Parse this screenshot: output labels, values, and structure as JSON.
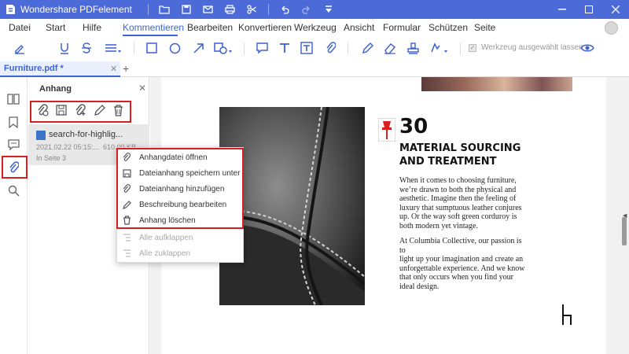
{
  "window": {
    "title": "Wondershare PDFelement"
  },
  "menu": [
    "Datei",
    "Start",
    "Hilfe",
    "Kommentieren",
    "Bearbeiten",
    "Konvertieren",
    "Werkzeug",
    "Ansicht",
    "Formular",
    "Schützen",
    "Seite"
  ],
  "menu_active": "Kommentieren",
  "toolbar": {
    "keep_tool_label": "Werkzeug ausgewählt lassen",
    "keep_tool_checked": true
  },
  "tab": {
    "name": "Furniture.pdf *"
  },
  "panel": {
    "title": "Anhang",
    "attachment": {
      "name": "search-for-highlig...",
      "date": "2021.02.22 05:15:...",
      "size": "610.00 KB",
      "page": "In Seite 3"
    }
  },
  "context_menu": {
    "items": [
      {
        "label": "Anhangdatei öffnen",
        "enabled": true
      },
      {
        "label": "Dateianhang speichern unter",
        "enabled": true
      },
      {
        "label": "Dateianhang hinzufügen",
        "enabled": true
      },
      {
        "label": "Beschreibung bearbeiten",
        "enabled": true
      },
      {
        "label": "Anhang löschen",
        "enabled": true
      },
      {
        "label": "Alle aufklappen",
        "enabled": false
      },
      {
        "label": "Alle zuklappen",
        "enabled": false
      }
    ]
  },
  "document": {
    "number": "30",
    "heading_line1": "MATERIAL SOURCING",
    "heading_line2": "AND TREATMENT",
    "para1": [
      "When it comes to choosing furniture,",
      "we’re drawn to both the physical and",
      "aesthetic. Imagine then the feeling of",
      "luxury that sumptuous leather conjures",
      "up. Or the way soft green corduroy is",
      "both modern yet vintage."
    ],
    "para2": [
      "At Columbia Collective, our passion is to",
      "light up your imagination and create an",
      "unforgettable experience. And we know",
      "that only occurs when you find your",
      "ideal design."
    ]
  },
  "colors": {
    "accent": "#4d6bd8",
    "highlight_box": "#d71f1f",
    "selected_row": "#e8e8e8"
  }
}
